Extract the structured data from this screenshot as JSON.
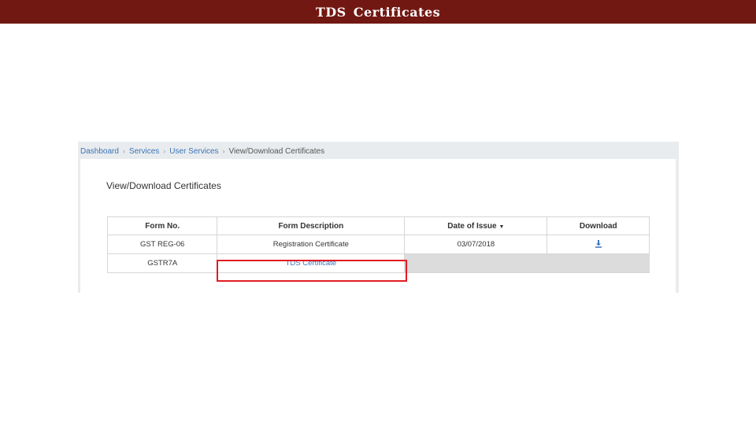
{
  "banner": {
    "title": "TDS Certificates",
    "color": "#721812"
  },
  "breadcrumb": {
    "items": [
      "Dashboard",
      "Services",
      "User Services"
    ],
    "current": "View/Download Certificates",
    "separator": "›"
  },
  "panel": {
    "title": "View/Download Certificates"
  },
  "table": {
    "headers": {
      "form_no": "Form No.",
      "description": "Form Description",
      "date": "Date of Issue",
      "download": "Download"
    },
    "sort_icon": "caret-down-icon",
    "rows": [
      {
        "form_no": "GST REG-06",
        "description": "Registration Certificate",
        "date": "03/07/2018",
        "download_icon": "download-icon"
      },
      {
        "form_no": "GSTR7A",
        "description": "TDS Certificate",
        "date": "",
        "download_icon": ""
      }
    ]
  },
  "colors": {
    "link": "#3b73b9",
    "highlight": "#e11b22"
  }
}
